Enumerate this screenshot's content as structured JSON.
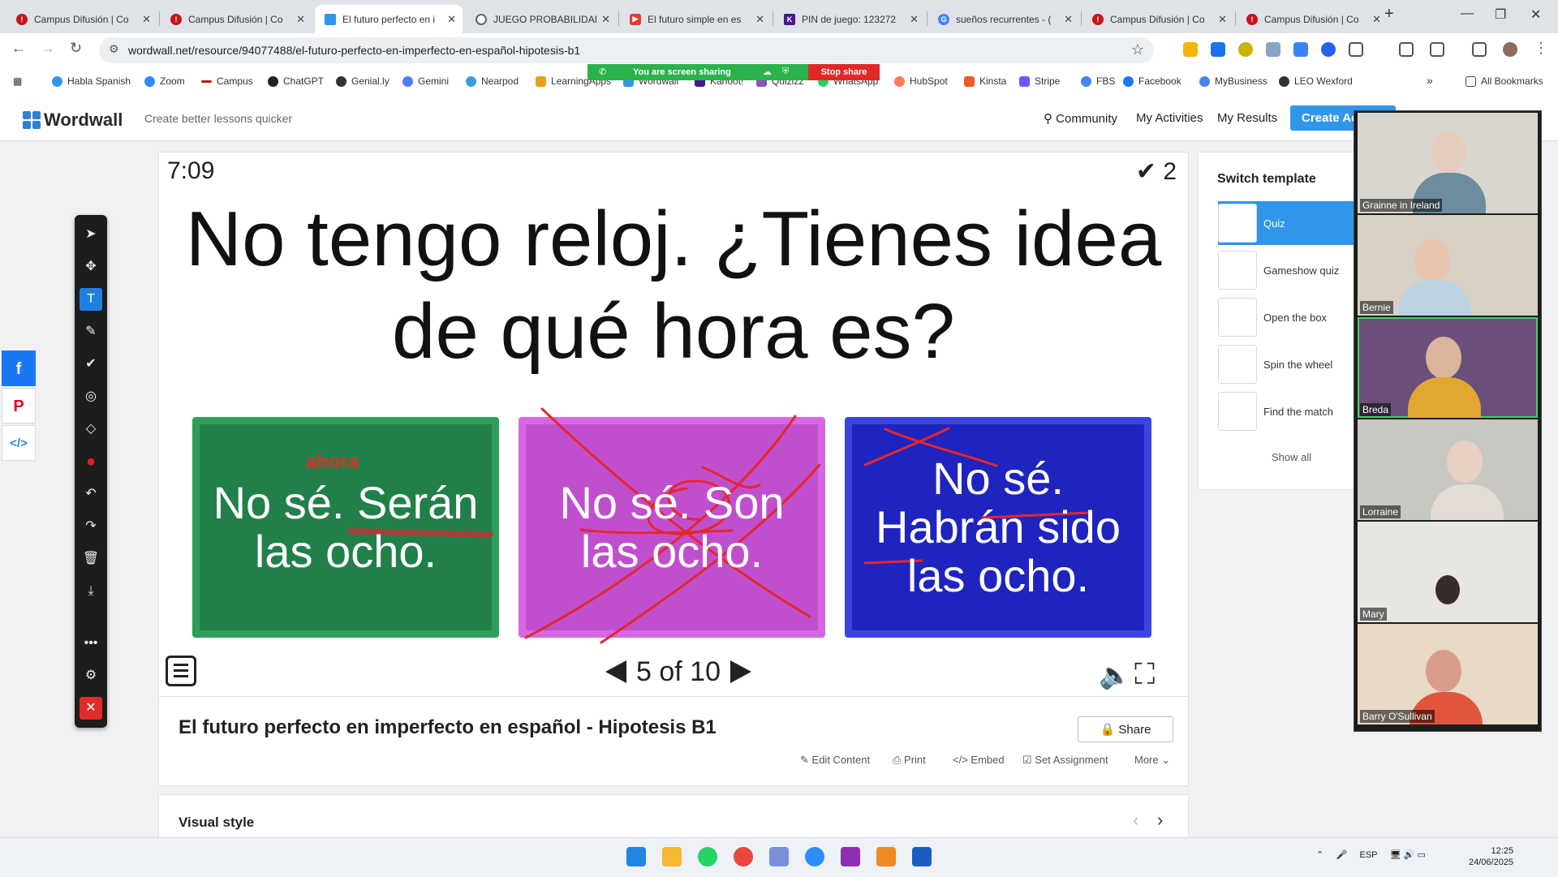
{
  "browser": {
    "tabs": [
      {
        "title": "Campus Difusión | Co",
        "color": "#c6151b"
      },
      {
        "title": "Campus Difusión | Co",
        "color": "#c6151b"
      },
      {
        "title": "El futuro perfecto en i",
        "color": "#2f96ea"
      },
      {
        "title": "JUEGO PROBABILIDAD",
        "color": "#5f6368"
      },
      {
        "title": "El futuro simple en es",
        "color": "#e53935"
      },
      {
        "title": "PIN de juego: 123272",
        "color": "#46178f"
      },
      {
        "title": "sueños recurrentes - (",
        "color": "#4285f4"
      },
      {
        "title": "Campus Difusión | Co",
        "color": "#c6151b"
      },
      {
        "title": "Campus Difusión | Co",
        "color": "#c6151b"
      }
    ],
    "new_tab": "+",
    "url": "wordwall.net/resource/94077488/el-futuro-perfecto-en-imperfecto-en-español-hipotesis-b1",
    "bookmarks": [
      {
        "label": "Habla Spanish",
        "color": "#2f96ea"
      },
      {
        "label": "Zoom",
        "color": "#2d8cff"
      },
      {
        "label": "Campus",
        "color": "#c6151b"
      },
      {
        "label": "ChatGPT",
        "color": "#222222"
      },
      {
        "label": "Genial.ly",
        "color": "#333333"
      },
      {
        "label": "Gemini",
        "color": "#4f7dfa"
      },
      {
        "label": "Nearpod",
        "color": "#3c9be0"
      },
      {
        "label": "LearningApps",
        "color": "#e8a21b"
      },
      {
        "label": "Wordwall",
        "color": "#2f96ea"
      },
      {
        "label": "Kahoot!",
        "color": "#46178f"
      },
      {
        "label": "Quizizz",
        "color": "#8854c0"
      },
      {
        "label": "WhatsApp",
        "color": "#25d366"
      },
      {
        "label": "HubSpot",
        "color": "#ff7a59"
      },
      {
        "label": "Kinsta",
        "color": "#ec5a27"
      },
      {
        "label": "Stripe",
        "color": "#635bff"
      },
      {
        "label": "FBS",
        "color": "#4285f4"
      },
      {
        "label": "Facebook",
        "color": "#1877f2"
      },
      {
        "label": "MyBusiness",
        "color": "#4285f4"
      },
      {
        "label": "LEO Wexford",
        "color": "#333333"
      }
    ],
    "more_bookmarks": "»",
    "all_bookmarks": "All Bookmarks"
  },
  "screenshare": {
    "status": "You are screen sharing",
    "stop": "Stop share"
  },
  "site": {
    "logo": "Wordwall",
    "tagline": "Create better lessons quicker",
    "nav": [
      "Community",
      "My Activities",
      "My Results"
    ],
    "create": "Create Activity"
  },
  "activity": {
    "timer": "7:09",
    "score": "2",
    "question": "No tengo reloj. ¿Tienes idea de qué hora es?",
    "answers": [
      "No sé. Serán las ocho.",
      "No sé. Son las ocho.",
      "No sé. Habrán sido las ocho."
    ],
    "annotation": "ahora",
    "page": "5 of 10",
    "title": "El futuro perfecto en imperfecto en español - Hipotesis B1",
    "share": "Share",
    "actions": [
      "Edit Content",
      "Print",
      "Embed",
      "Set Assignment",
      "More"
    ],
    "visual_style": "Visual style"
  },
  "switch_template": {
    "title": "Switch template",
    "items": [
      "Quiz",
      "Gameshow quiz",
      "Open the box",
      "Spin the wheel",
      "Find the match"
    ],
    "show_all": "Show all"
  },
  "participants": [
    "Grainne in Ireland",
    "Bernie",
    "Breda",
    "Lorraine",
    "Mary",
    "Barry O'Sullivan"
  ],
  "taskbar": {
    "language": "ESP",
    "time": "12:25",
    "date": "24/06/2025"
  }
}
